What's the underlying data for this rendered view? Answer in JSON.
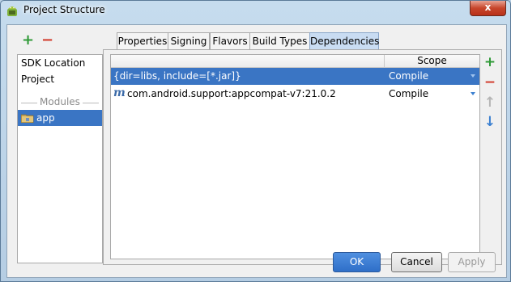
{
  "window": {
    "title": "Project Structure",
    "close_label": "x"
  },
  "toolbar": {
    "add_label": "+",
    "remove_label": "−"
  },
  "left_panel": {
    "items": [
      "SDK Location",
      "Project"
    ],
    "modules_header": "Modules",
    "modules": [
      "app"
    ]
  },
  "tabs": [
    {
      "label": "Properties"
    },
    {
      "label": "Signing"
    },
    {
      "label": "Flavors"
    },
    {
      "label": "Build Types"
    },
    {
      "label": "Dependencies",
      "active": true
    }
  ],
  "dependencies": {
    "headers": {
      "name": "",
      "scope": "Scope"
    },
    "rows": [
      {
        "name": "{dir=libs, include=[*.jar]}",
        "scope": "Compile",
        "selected": true,
        "icon": "none"
      },
      {
        "name": "com.android.support:appcompat-v7:21.0.2",
        "scope": "Compile",
        "selected": false,
        "icon": "maven-icon",
        "icon_text": "m"
      }
    ],
    "side_buttons": {
      "add": "+",
      "remove": "−",
      "up": "↑",
      "down": "↓"
    }
  },
  "buttons": {
    "ok": "OK",
    "cancel": "Cancel",
    "apply": "Apply"
  },
  "colors": {
    "selection": "#3a75c4",
    "add": "#2f9a37",
    "remove": "#d23b2c",
    "ok": "#2f6fc8"
  }
}
